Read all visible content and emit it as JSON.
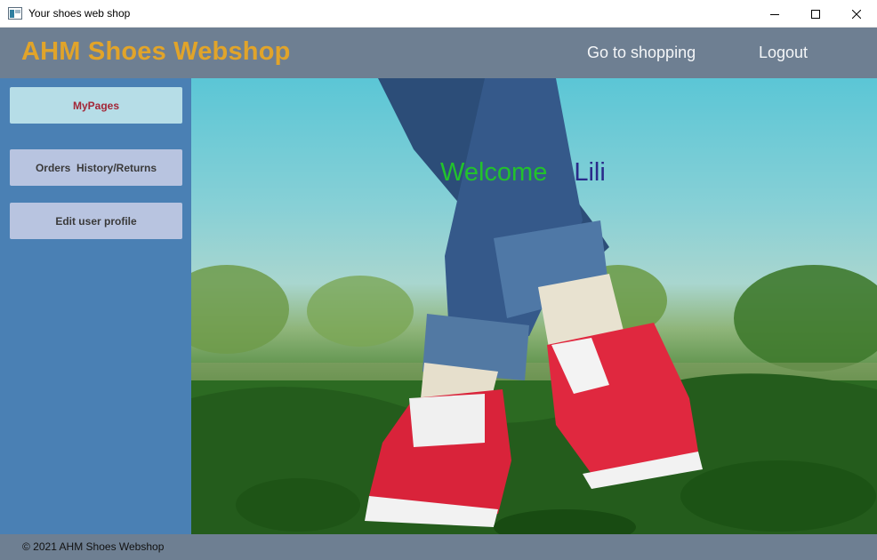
{
  "window": {
    "title": "Your shoes web shop",
    "icon": "app-window-icon",
    "controls": [
      "minimize-icon",
      "maximize-icon",
      "close-icon"
    ]
  },
  "header": {
    "brand": "AHM Shoes Webshop",
    "nav": {
      "shopping": "Go to shopping",
      "logout": "Logout"
    }
  },
  "sidebar": {
    "items": [
      {
        "label": "MyPages",
        "active": true
      },
      {
        "label": "Orders  History/Returns",
        "active": false
      },
      {
        "label": "Edit user profile",
        "active": false
      }
    ]
  },
  "main": {
    "welcome_word": "Welcome",
    "user_name": "Lili"
  },
  "footer": {
    "copyright": "© 2021 AHM Shoes Webshop"
  },
  "colors": {
    "header_bg": "#6e7f92",
    "brand": "#e1a42a",
    "sidebar_bg": "#4a80b4",
    "active_button_bg": "#b6dde7",
    "active_button_text": "#a32637",
    "button_bg": "#b8c4e0",
    "welcome_green": "#22c22c",
    "name_navy": "#2a2a8a"
  }
}
